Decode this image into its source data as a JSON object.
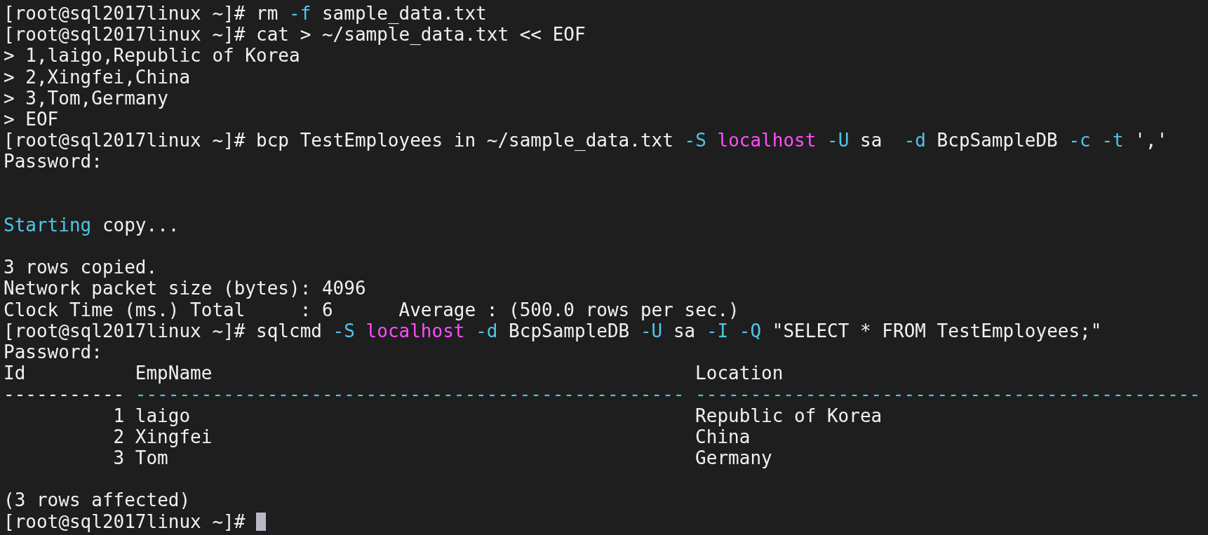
{
  "terminal": {
    "lines": [
      {
        "kind": "text",
        "segments": [
          {
            "text": "[root@sql2017linux ~]# rm ",
            "kind": "plain"
          },
          {
            "text": "-f",
            "kind": "option"
          },
          {
            "text": " sample_data.txt",
            "kind": "plain"
          }
        ]
      },
      {
        "kind": "text",
        "segments": [
          {
            "text": "[root@sql2017linux ~]# cat > ~/sample_data.txt << EOF",
            "kind": "plain"
          }
        ]
      },
      {
        "kind": "text",
        "segments": [
          {
            "text": "> 1,laigo,Republic of Korea",
            "kind": "plain"
          }
        ]
      },
      {
        "kind": "text",
        "segments": [
          {
            "text": "> 2,Xingfei,China",
            "kind": "plain"
          }
        ]
      },
      {
        "kind": "text",
        "segments": [
          {
            "text": "> 3,Tom,Germany",
            "kind": "plain"
          }
        ]
      },
      {
        "kind": "text",
        "segments": [
          {
            "text": "> EOF",
            "kind": "plain"
          }
        ]
      },
      {
        "kind": "text",
        "segments": [
          {
            "text": "[root@sql2017linux ~]# bcp TestEmployees in ~/sample_data.txt ",
            "kind": "plain"
          },
          {
            "text": "-S ",
            "kind": "option"
          },
          {
            "text": "localhost ",
            "kind": "host"
          },
          {
            "text": "-U",
            "kind": "option"
          },
          {
            "text": " sa  ",
            "kind": "plain"
          },
          {
            "text": "-d",
            "kind": "option"
          },
          {
            "text": " BcpSampleDB ",
            "kind": "plain"
          },
          {
            "text": "-c -t",
            "kind": "option"
          },
          {
            "text": " ','",
            "kind": "plain"
          }
        ]
      },
      {
        "kind": "text",
        "segments": [
          {
            "text": "Password:",
            "kind": "plain"
          }
        ]
      },
      {
        "kind": "blank"
      },
      {
        "kind": "blank"
      },
      {
        "kind": "text",
        "segments": [
          {
            "text": "Starting",
            "kind": "option"
          },
          {
            "text": " copy...",
            "kind": "plain"
          }
        ]
      },
      {
        "kind": "blank"
      },
      {
        "kind": "text",
        "segments": [
          {
            "text": "3 rows copied.",
            "kind": "plain"
          }
        ]
      },
      {
        "kind": "text",
        "segments": [
          {
            "text": "Network packet size (bytes): 4096",
            "kind": "plain"
          }
        ]
      },
      {
        "kind": "text",
        "segments": [
          {
            "text": "Clock Time (ms.) Total     : 6      Average : (500.0 rows per sec.)",
            "kind": "plain"
          }
        ]
      },
      {
        "kind": "text",
        "segments": [
          {
            "text": "[root@sql2017linux ~]# sqlcmd ",
            "kind": "plain"
          },
          {
            "text": "-S ",
            "kind": "option"
          },
          {
            "text": "localhost ",
            "kind": "host"
          },
          {
            "text": "-d",
            "kind": "option"
          },
          {
            "text": " BcpSampleDB ",
            "kind": "plain"
          },
          {
            "text": "-U",
            "kind": "option"
          },
          {
            "text": " sa ",
            "kind": "plain"
          },
          {
            "text": "-I -Q",
            "kind": "option"
          },
          {
            "text": " \"SELECT * FROM TestEmployees;\"",
            "kind": "plain"
          }
        ]
      },
      {
        "kind": "text",
        "segments": [
          {
            "text": "Password:",
            "kind": "plain"
          }
        ]
      },
      {
        "kind": "table",
        "columns": [
          "Id",
          "EmpName",
          "Location"
        ],
        "separators": [
          {
            "text": "-----------",
            "kind": "plain"
          },
          {
            "text": "--------------------------------------------------",
            "kind": "option"
          },
          {
            "text": "----------------------------------------------",
            "kind": "option"
          }
        ],
        "rows": [
          [
            "1",
            "laigo",
            "Republic of Korea"
          ],
          [
            "2",
            "Xingfei",
            "China"
          ],
          [
            "3",
            "Tom",
            "Germany"
          ]
        ]
      },
      {
        "kind": "blank"
      },
      {
        "kind": "text",
        "segments": [
          {
            "text": "(3 rows affected)",
            "kind": "plain"
          }
        ]
      },
      {
        "kind": "prompt",
        "segments": [
          {
            "text": "[root@sql2017linux ~]# ",
            "kind": "plain"
          }
        ],
        "cursor": true
      }
    ]
  }
}
